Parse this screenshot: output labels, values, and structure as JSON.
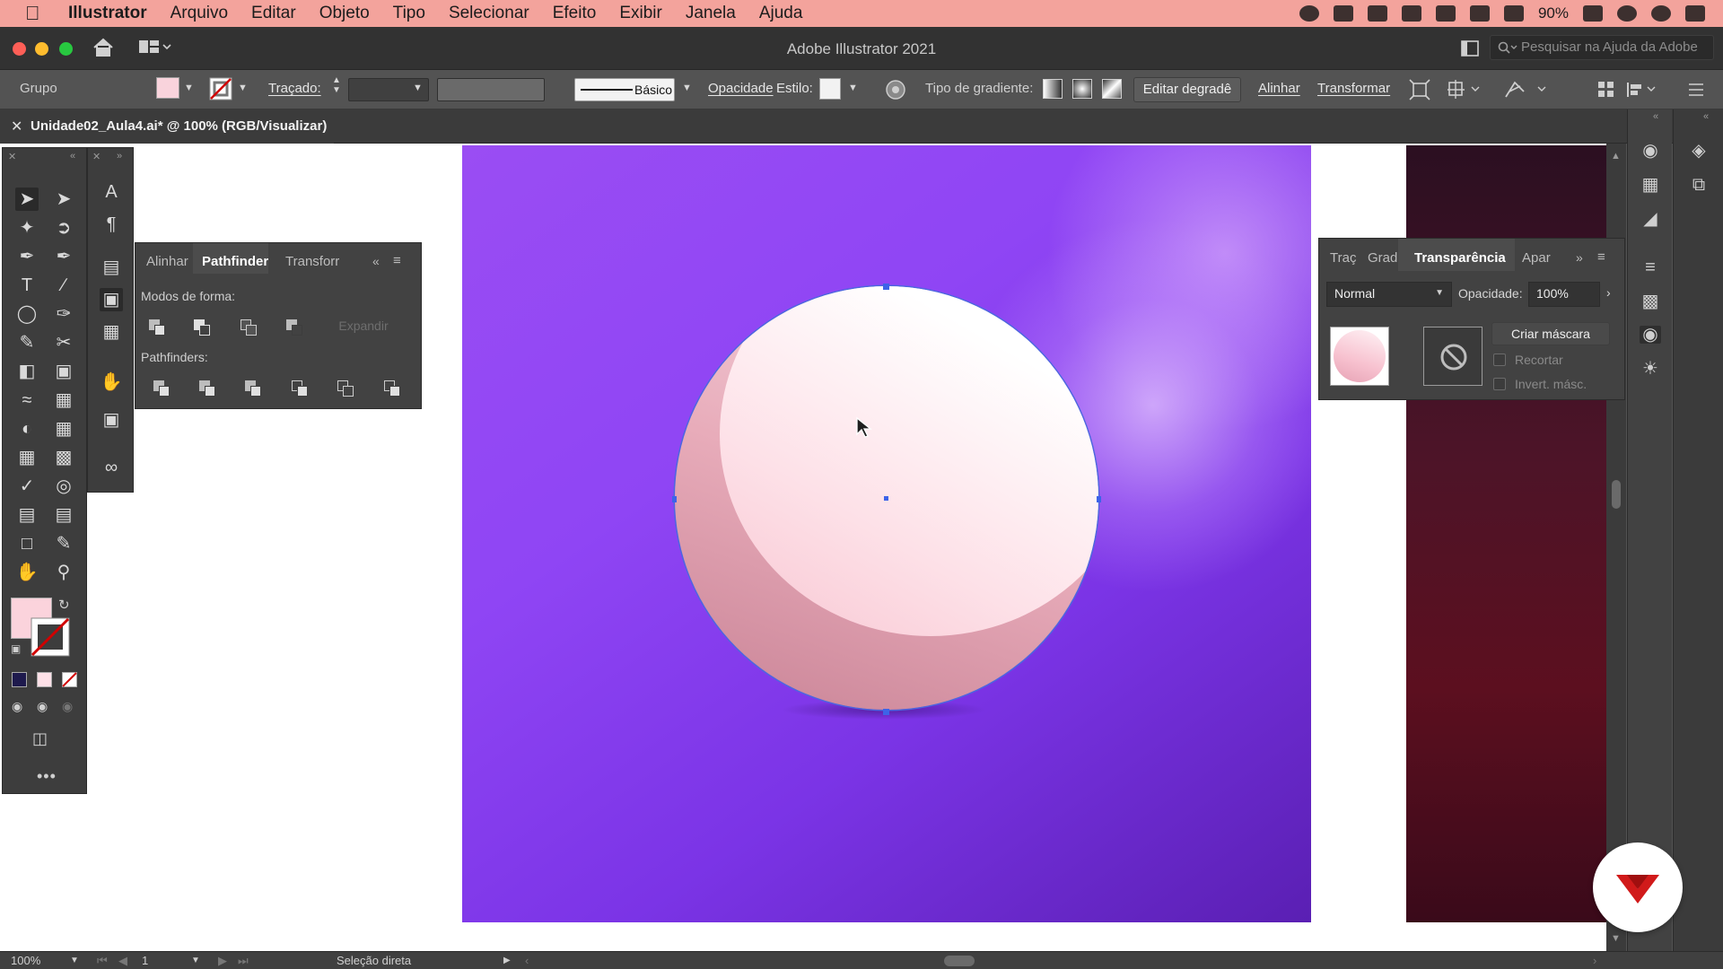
{
  "menubar": {
    "apple_icon": "apple-icon",
    "items": [
      "Illustrator",
      "Arquivo",
      "Editar",
      "Objeto",
      "Tipo",
      "Selecionar",
      "Efeito",
      "Exibir",
      "Janela",
      "Ajuda"
    ],
    "battery": "90%"
  },
  "window": {
    "title": "Adobe Illustrator 2021",
    "search_placeholder": "Pesquisar na Ajuda da Adobe"
  },
  "control": {
    "selection_type": "Grupo",
    "stroke_label": "Traçado:",
    "stroke_style": "Básico",
    "opacity_label": "Opacidade",
    "style_label": "Estilo:",
    "gradient_type_label": "Tipo de gradiente:",
    "edit_gradient_button": "Editar degradê",
    "align_link": "Alinhar",
    "transform_link": "Transformar"
  },
  "document": {
    "tab_title": "Unidade02_Aula4.ai* @ 100% (RGB/Visualizar)"
  },
  "pathfinder_panel": {
    "tabs": [
      "Alinhar",
      "Pathfinder",
      "Transforr"
    ],
    "active_tab": "Pathfinder",
    "shape_modes_label": "Modos de forma:",
    "expand_button": "Expandir",
    "pathfinders_label": "Pathfinders:"
  },
  "transparency_panel": {
    "tabs": [
      "Traç",
      "Grad",
      "Transparência",
      "Apar"
    ],
    "active_tab": "Transparência",
    "blend_mode": "Normal",
    "opacity_label": "Opacidade:",
    "opacity_value": "100%",
    "make_mask_button": "Criar máscara",
    "clip_label": "Recortar",
    "invert_mask_label": "Invert. másc."
  },
  "status": {
    "zoom": "100%",
    "artboard_number": "1",
    "current_tool": "Seleção direta"
  },
  "colors": {
    "menubar_bg": "#f3a39c",
    "ui_bg": "#535353",
    "artboard_purple": "#8f45f4",
    "sphere_pink": "#f8c6d2",
    "selection_blue": "#3d63e8",
    "logo_red": "#d11a1a"
  }
}
